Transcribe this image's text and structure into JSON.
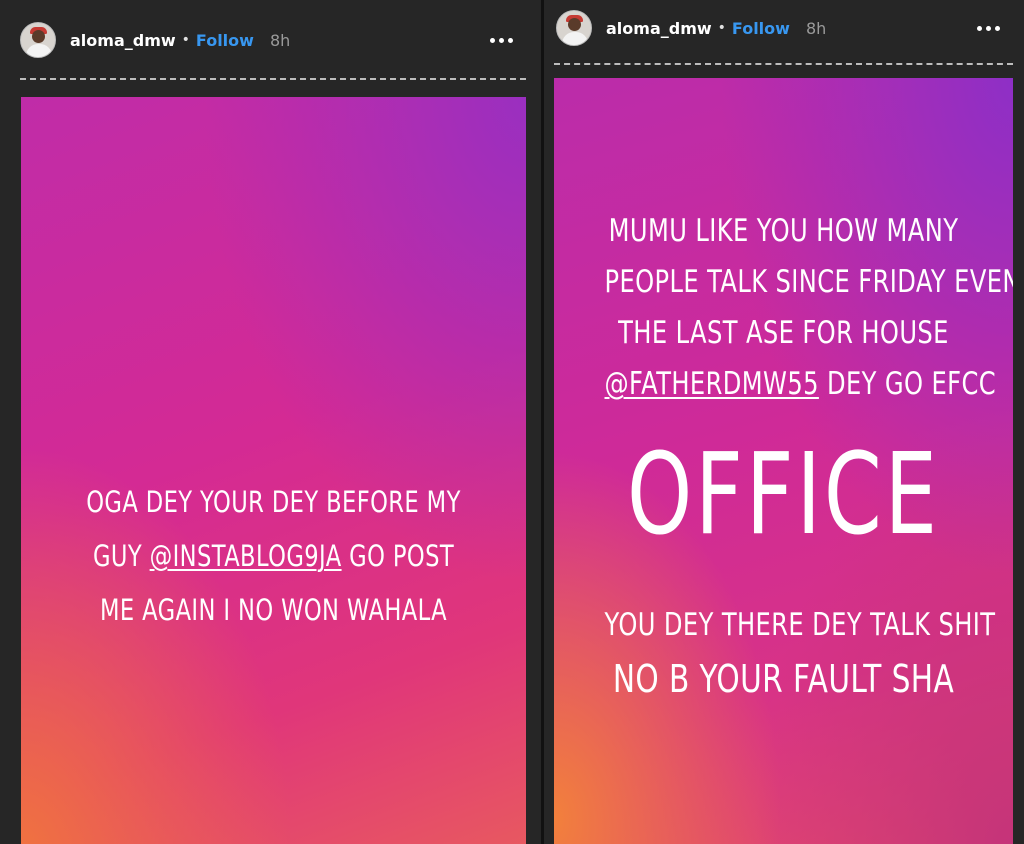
{
  "stories": [
    {
      "username": "aloma_dmw",
      "separator": "•",
      "follow_label": "Follow",
      "time": "8h",
      "more_icon": "more-horizontal-icon",
      "caption": {
        "lines": [
          {
            "text": "OGA DEY YOUR DEY BEFORE MY"
          },
          {
            "pre": "GUY ",
            "mention": "@INSTABLOG9JA",
            "post": " GO POST"
          },
          {
            "text": "ME AGAIN I NO WON WAHALA"
          }
        ]
      }
    },
    {
      "username": "aloma_dmw",
      "separator": "•",
      "follow_label": "Follow",
      "time": "8h",
      "more_icon": "more-horizontal-icon",
      "caption_top": {
        "lines": [
          {
            "text": "MUMU LIKE YOU HOW MANY"
          },
          {
            "text": "PEOPLE TALK SINCE FRIDAY EVEN"
          },
          {
            "text": "THE LAST ASE FOR HOUSE"
          },
          {
            "mention": "@FATHERDMW55",
            "post": " DEY GO EFCC"
          }
        ]
      },
      "caption_big": "OFFICE",
      "caption_bottom": {
        "lines": [
          {
            "text": "YOU DEY THERE DEY TALK SHIT"
          },
          {
            "text": "NO B YOUR FAULT SHA"
          }
        ]
      }
    }
  ],
  "colors": {
    "background": "#262626",
    "follow": "#3897f0",
    "story_gradient": [
      "#9a2fc0",
      "#d42a94",
      "#f0733f"
    ]
  }
}
